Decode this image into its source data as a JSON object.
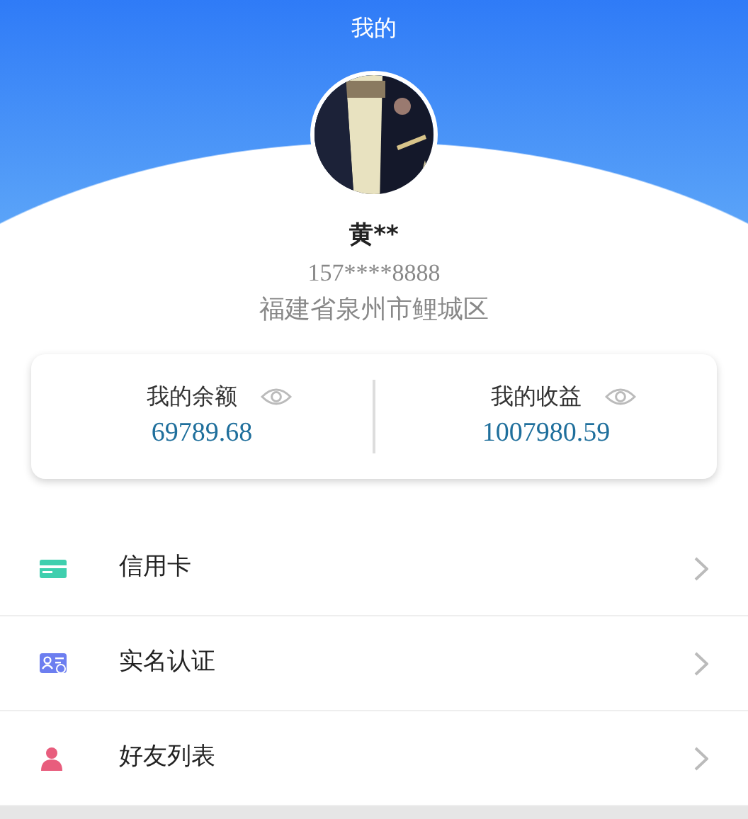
{
  "header": {
    "title": "我的"
  },
  "profile": {
    "name": "黄**",
    "phone": "157****8888",
    "address": "福建省泉州市鲤城区"
  },
  "summary": [
    {
      "label": "我的余额",
      "amount": "69789.68"
    },
    {
      "label": "我的收益",
      "amount": "1007980.59"
    }
  ],
  "menu": [
    {
      "kind": "card",
      "label": "信用卡",
      "color": "#3fcfae"
    },
    {
      "kind": "id",
      "label": "实名认证",
      "color": "#6c7ef0"
    },
    {
      "kind": "person",
      "label": "好友列表",
      "color": "#e85d7d"
    }
  ]
}
